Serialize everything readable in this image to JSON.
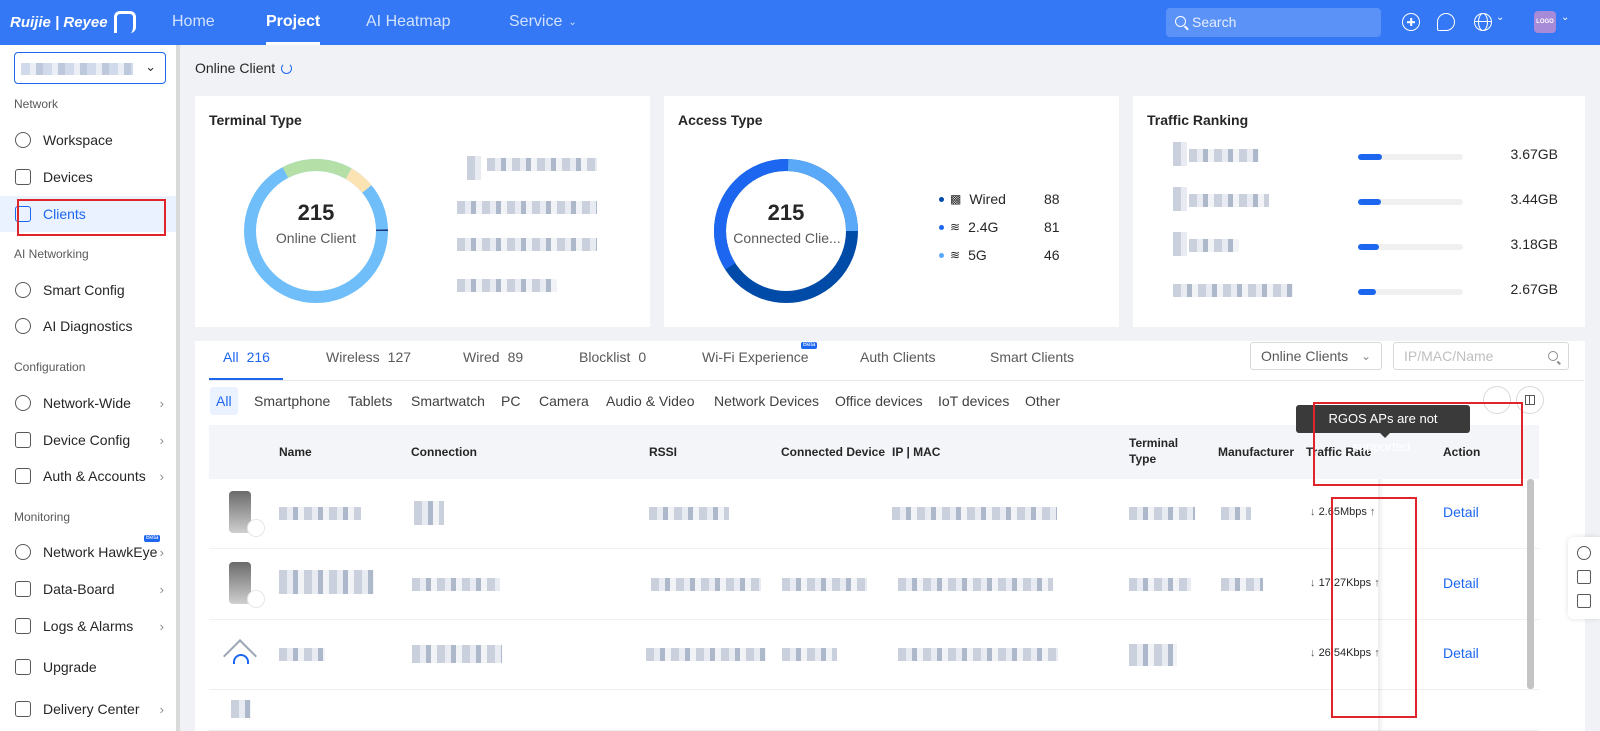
{
  "header": {
    "logo_text": "Ruijie | Reyee",
    "nav": [
      "Home",
      "Project",
      "AI Heatmap",
      "Service"
    ],
    "active_nav": "Project",
    "search_placeholder": "Search",
    "avatar_text": "LOGO"
  },
  "sidebar": {
    "sections": {
      "network": "Network",
      "ai": "AI Networking",
      "config": "Configuration",
      "monitoring": "Monitoring"
    },
    "items": {
      "workspace": "Workspace",
      "devices": "Devices",
      "clients": "Clients",
      "smart_config": "Smart Config",
      "ai_diagnostics": "AI Diagnostics",
      "network_wide": "Network-Wide",
      "device_config": "Device Config",
      "auth_accounts": "Auth & Accounts",
      "hawkeye": "Network HawkEye",
      "data_board": "Data-Board",
      "logs_alarms": "Logs & Alarms",
      "upgrade": "Upgrade",
      "delivery_center": "Delivery Center"
    },
    "beta_badge": "Beta"
  },
  "page": {
    "title": "Online Client"
  },
  "terminal_card": {
    "title": "Terminal Type",
    "total": "215",
    "total_label": "Online Client"
  },
  "access_card": {
    "title": "Access Type",
    "total": "215",
    "total_label": "Connected Clie...",
    "legend": [
      {
        "label": "Wired",
        "value": "88"
      },
      {
        "label": "2.4G",
        "value": "81"
      },
      {
        "label": "5G",
        "value": "46"
      }
    ]
  },
  "traffic_card": {
    "title": "Traffic Ranking",
    "rows": [
      {
        "value": "3.67GB",
        "fill": 0.23
      },
      {
        "value": "3.44GB",
        "fill": 0.22
      },
      {
        "value": "3.18GB",
        "fill": 0.2
      },
      {
        "value": "2.67GB",
        "fill": 0.17
      }
    ]
  },
  "tabs": [
    {
      "label": "All",
      "count": "216"
    },
    {
      "label": "Wireless",
      "count": "127"
    },
    {
      "label": "Wired",
      "count": "89"
    },
    {
      "label": "Blocklist",
      "count": "0"
    },
    {
      "label": "Wi-Fi Experience",
      "count": ""
    },
    {
      "label": "Auth Clients",
      "count": ""
    },
    {
      "label": "Smart Clients",
      "count": ""
    }
  ],
  "filter": {
    "select_value": "Online Clients",
    "search_placeholder": "IP/MAC/Name"
  },
  "chips": [
    "All",
    "Smartphone",
    "Tablets",
    "Smartwatch",
    "PC",
    "Camera",
    "Audio & Video",
    "Network Devices",
    "Office devices",
    "IoT devices",
    "Other"
  ],
  "table": {
    "headers": {
      "name": "Name",
      "connection": "Connection",
      "rssi": "RSSI",
      "connected_device": "Connected Device",
      "ip_mac": "IP | MAC",
      "terminal_type": "Terminal Type",
      "manufacturer": "Manufacturer",
      "traffic_rate": "Traffic Rate",
      "action": "Action"
    },
    "rows": [
      {
        "rate": "2.65Mbps",
        "action": "Detail"
      },
      {
        "rate": "17.27Kbps",
        "action": "Detail"
      },
      {
        "rate": "26.54Kbps",
        "action": "Detail"
      }
    ]
  },
  "tooltip": "RGOS APs are not supported.",
  "colors": {
    "brand": "#3478f6",
    "accent": "#1d67f0",
    "highlight": "#e0242b"
  }
}
